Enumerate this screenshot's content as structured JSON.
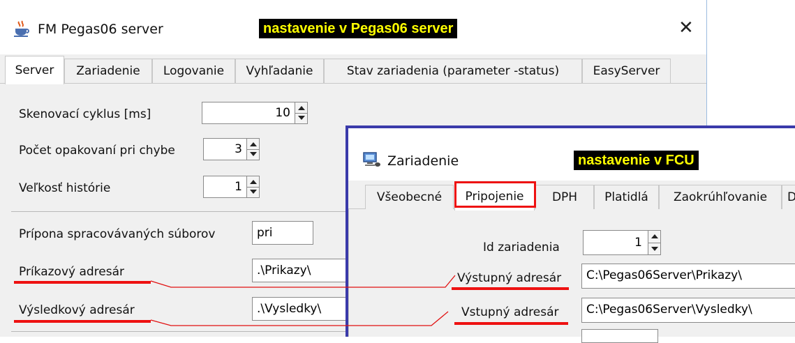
{
  "win1": {
    "title": "FM Pegas06 server",
    "banner": "nastavenie v Pegas06 server",
    "close_glyph": "✕",
    "tabs": [
      "Server",
      "Zariadenie",
      "Logovanie",
      "Vyhľadanie",
      "Stav zariadenia (parameter -status)",
      "EasyServer"
    ],
    "active_tab": "Server",
    "fields": {
      "scan_cycle_label": "Skenovací cyklus [ms]",
      "scan_cycle_value": "10",
      "retry_label": "Počet opakovaní pri chybe",
      "retry_value": "3",
      "history_label": "Veľkosť histórie",
      "history_value": "1",
      "suffix_label": "Prípona spracovávaných súborov",
      "suffix_value": "pri",
      "command_dir_label": "Príkazový adresár",
      "command_dir_value": ".\\Prikazy\\",
      "result_dir_label": "Výsledkový adresár",
      "result_dir_value": ".\\Vysledky\\"
    }
  },
  "win2": {
    "title": "Zariadenie",
    "banner": "nastavenie v  FCU",
    "tabs": [
      "Všeobecné",
      "Pripojenie",
      "DPH",
      "Platidlá",
      "Zaokrúhľovanie",
      "D"
    ],
    "active_tab": "Pripojenie",
    "fields": {
      "device_id_label": "Id zariadenia",
      "device_id_value": "1",
      "output_dir_label": "Výstupný adresár",
      "output_dir_value": "C:\\Pegas06Server\\Prikazy\\",
      "input_dir_label": "Vstupný adresár",
      "input_dir_value": "C:\\Pegas06Server\\Vysledky\\"
    }
  },
  "colors": {
    "banner_bg": "#000000",
    "banner_text": "#ffff00",
    "annotation_red": "#e11111",
    "window2_border": "#3a3aaa"
  },
  "icons": {
    "win1_icon": "java-cup-icon",
    "win2_icon": "computer-icon"
  }
}
